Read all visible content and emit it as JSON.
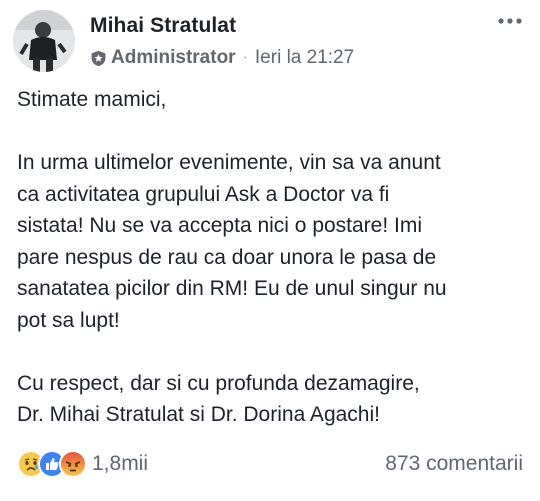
{
  "post": {
    "author": "Mihai Stratulat",
    "role": "Administrator",
    "separator": "·",
    "timestamp": "Ieri la 21:27",
    "body": {
      "greeting": "Stimate mamici,",
      "lines": [
        "In urma ultimelor evenimente, vin sa va anunt",
        "ca activitatea grupului Ask a Doctor va fi",
        "sistata! Nu se va accepta nici o postare! Imi",
        "pare nespus de rau ca doar unora le pasa de",
        "sanatatea picilor din RM! Eu de unul singur nu",
        "pot sa lupt!"
      ],
      "closing": [
        "Cu respect, dar si cu profunda dezamagire,",
        "Dr. Mihai Stratulat si Dr. Dorina Agachi!"
      ]
    },
    "reactions": {
      "icons": [
        "sad-reaction-icon",
        "like-reaction-icon",
        "angry-reaction-icon"
      ],
      "count": "1,8mii"
    },
    "comments": "873 comentarii"
  }
}
